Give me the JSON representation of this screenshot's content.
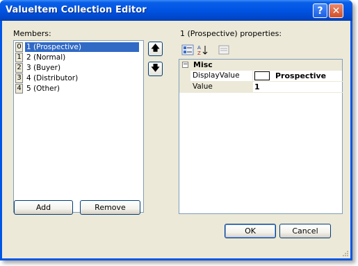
{
  "window": {
    "title": "ValueItem Collection Editor"
  },
  "titlebar_buttons": {
    "help": "?",
    "close": "✕"
  },
  "members": {
    "label": "Members:",
    "items": [
      {
        "index": "0",
        "text": "1 (Prospective)",
        "selected": true
      },
      {
        "index": "1",
        "text": "2 (Normal)"
      },
      {
        "index": "2",
        "text": "3 (Buyer)"
      },
      {
        "index": "3",
        "text": "4 (Distributor)"
      },
      {
        "index": "4",
        "text": "5 (Other)"
      }
    ]
  },
  "arrows": {
    "up": "🡅",
    "down": "🡇"
  },
  "buttons": {
    "add": "Add",
    "remove": "Remove",
    "ok": "OK",
    "cancel": "Cancel"
  },
  "properties": {
    "label": "1 (Prospective) properties:",
    "toolbar": {
      "categorized": "categorized-icon",
      "alphabetical": "alphabetical-icon",
      "pages": "property-pages-icon"
    },
    "category": "Misc",
    "rows": [
      {
        "name": "DisplayValue",
        "value": "Prospective"
      },
      {
        "name": "Value",
        "value": "1"
      }
    ]
  }
}
